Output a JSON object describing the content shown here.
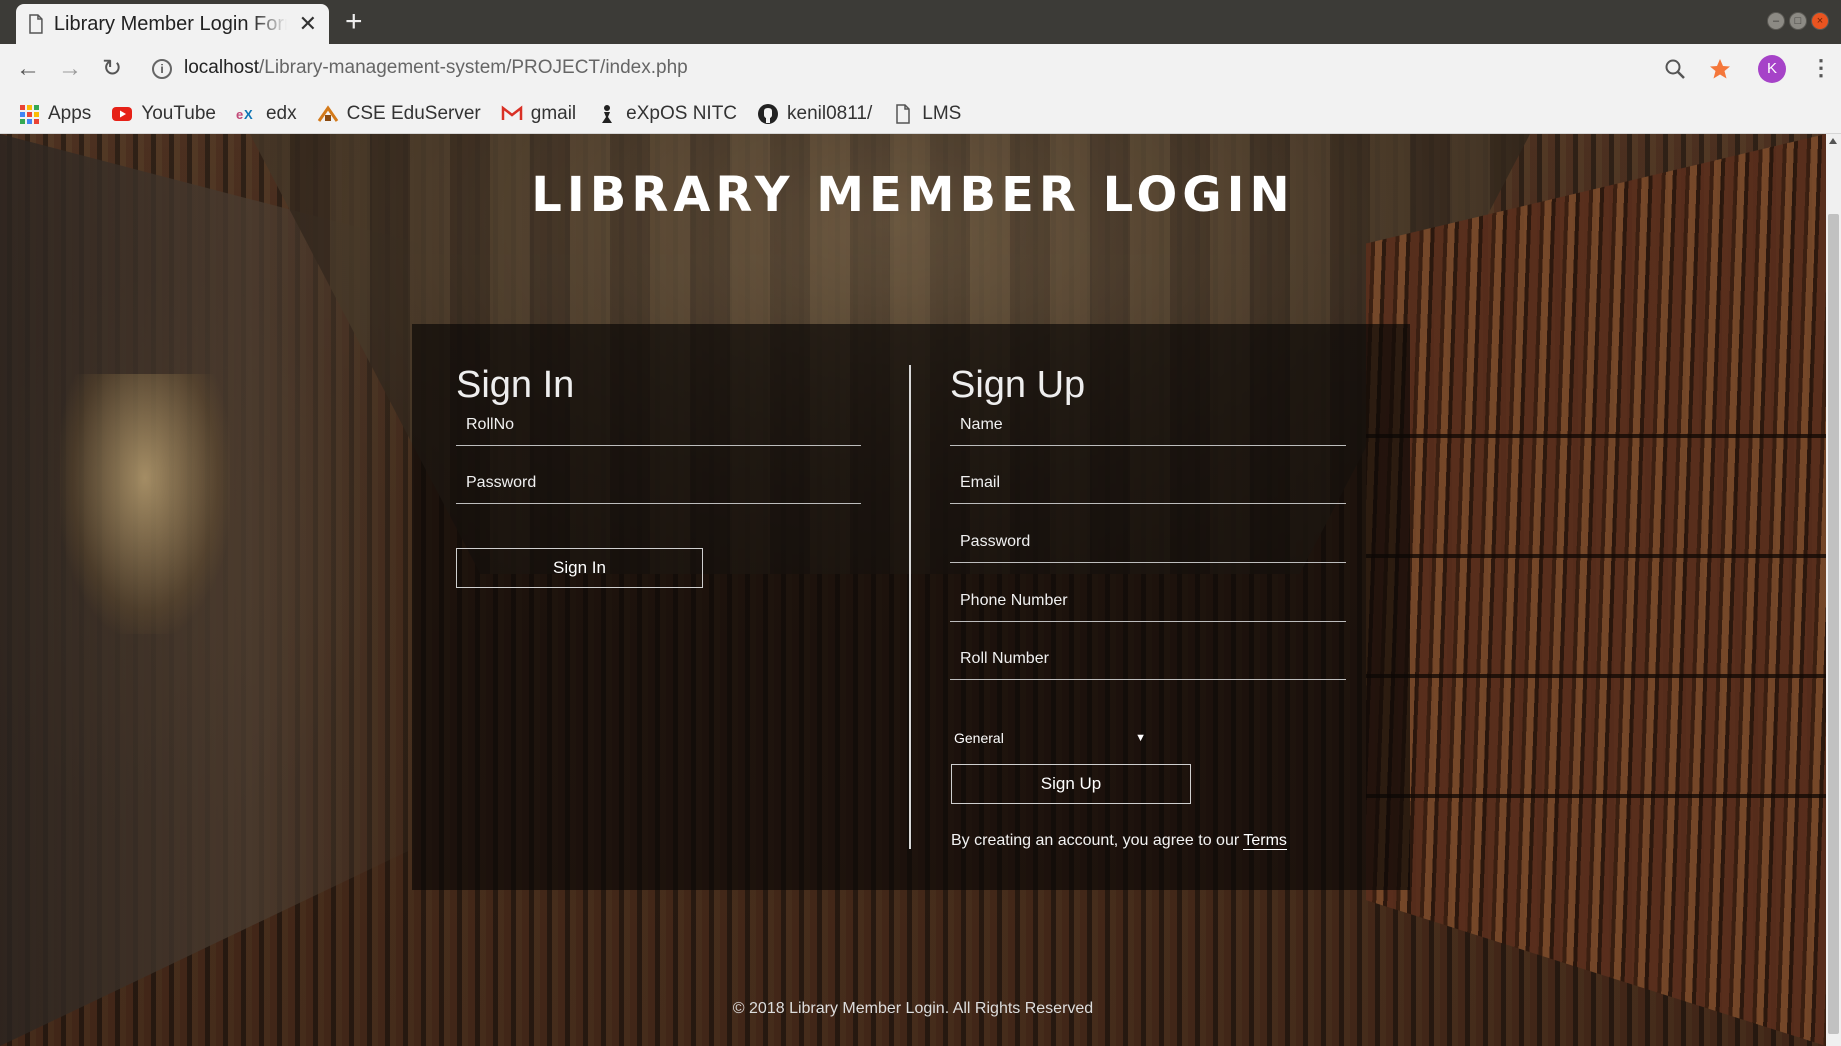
{
  "browser": {
    "tab_title": "Library Member Login Form",
    "tab_close": "✕",
    "new_tab": "+",
    "url_host": "localhost",
    "url_path": "/Library-management-system/PROJECT/index.php",
    "avatar_letter": "K",
    "bookmarks": [
      {
        "label": "Apps",
        "icon": "apps-grid-icon"
      },
      {
        "label": "YouTube",
        "icon": "youtube-icon"
      },
      {
        "label": "edx",
        "icon": "edx-icon"
      },
      {
        "label": "CSE EduServer",
        "icon": "eduserver-icon"
      },
      {
        "label": "gmail",
        "icon": "gmail-icon"
      },
      {
        "label": "eXpOS NITC",
        "icon": "expos-icon"
      },
      {
        "label": "kenil0811/",
        "icon": "github-icon"
      },
      {
        "label": "LMS",
        "icon": "page-icon"
      }
    ]
  },
  "page": {
    "title": "LIBRARY MEMBER LOGIN",
    "footer": "© 2018 Library Member Login. All Rights Reserved",
    "signin": {
      "heading": "Sign In",
      "rollno_placeholder": "RollNo",
      "password_placeholder": "Password",
      "button": "Sign In"
    },
    "signup": {
      "heading": "Sign Up",
      "name_placeholder": "Name",
      "email_placeholder": "Email",
      "password_placeholder": "Password",
      "phone_placeholder": "Phone Number",
      "roll_placeholder": "Roll Number",
      "category_selected": "General",
      "button": "Sign Up",
      "terms_text": "By creating an account, you agree to our ",
      "terms_link": "Terms"
    }
  },
  "colors": {
    "accent_star": "#f4773b",
    "avatar": "#a643c8"
  }
}
